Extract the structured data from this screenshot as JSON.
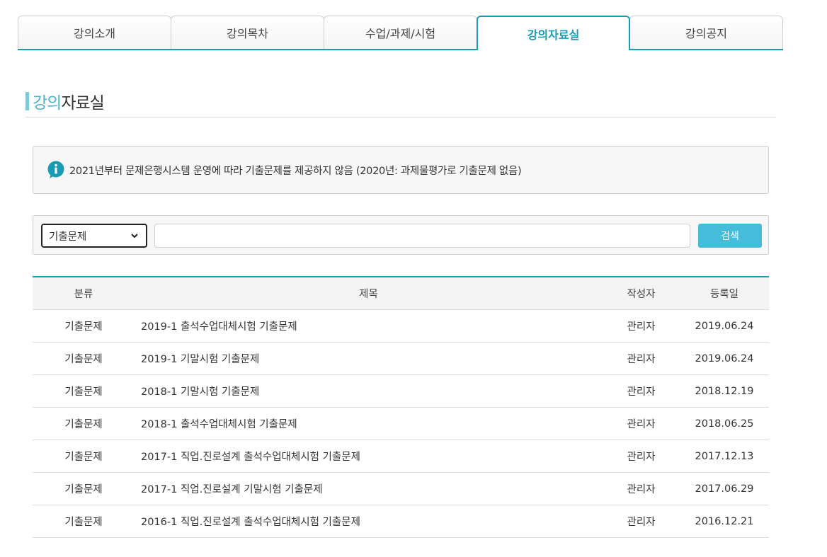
{
  "tabs": [
    {
      "label": "강의소개",
      "active": false
    },
    {
      "label": "강의목차",
      "active": false
    },
    {
      "label": "수업/과제/시험",
      "active": false
    },
    {
      "label": "강의자료실",
      "active": true
    },
    {
      "label": "강의공지",
      "active": false
    }
  ],
  "section": {
    "title_accent": "강의",
    "title_rest": "자료실"
  },
  "notice": {
    "icon": "info-icon",
    "text": "2021년부터 문제은행시스템 운영에 따라 기출문제를 제공하지 않음 (2020년: 과제물평가로 기출문제 없음)"
  },
  "search": {
    "category_selected": "기출문제",
    "query_value": "",
    "button_label": "검색"
  },
  "table": {
    "headers": {
      "category": "분류",
      "title": "제목",
      "author": "작성자",
      "date": "등록일"
    },
    "rows": [
      {
        "category": "기출문제",
        "title": "2019-1 출석수업대체시험 기출문제",
        "author": "관리자",
        "date": "2019.06.24"
      },
      {
        "category": "기출문제",
        "title": "2019-1 기말시험 기출문제",
        "author": "관리자",
        "date": "2019.06.24"
      },
      {
        "category": "기출문제",
        "title": "2018-1 기말시험 기출문제",
        "author": "관리자",
        "date": "2018.12.19"
      },
      {
        "category": "기출문제",
        "title": "2018-1 출석수업대체시험 기출문제",
        "author": "관리자",
        "date": "2018.06.25"
      },
      {
        "category": "기출문제",
        "title": "2017-1 직업.진로설계 출석수업대체시험 기출문제",
        "author": "관리자",
        "date": "2017.12.13"
      },
      {
        "category": "기출문제",
        "title": "2017-1 직업.진로설계 기말시험 기출문제",
        "author": "관리자",
        "date": "2017.06.29"
      },
      {
        "category": "기출문제",
        "title": "2016-1 직업.진로설계 출석수업대체시험 기출문제",
        "author": "관리자",
        "date": "2016.12.21"
      }
    ]
  },
  "colors": {
    "accent": "#1a9bb4",
    "button": "#45bcda",
    "title_accent": "#4fb3c8"
  }
}
